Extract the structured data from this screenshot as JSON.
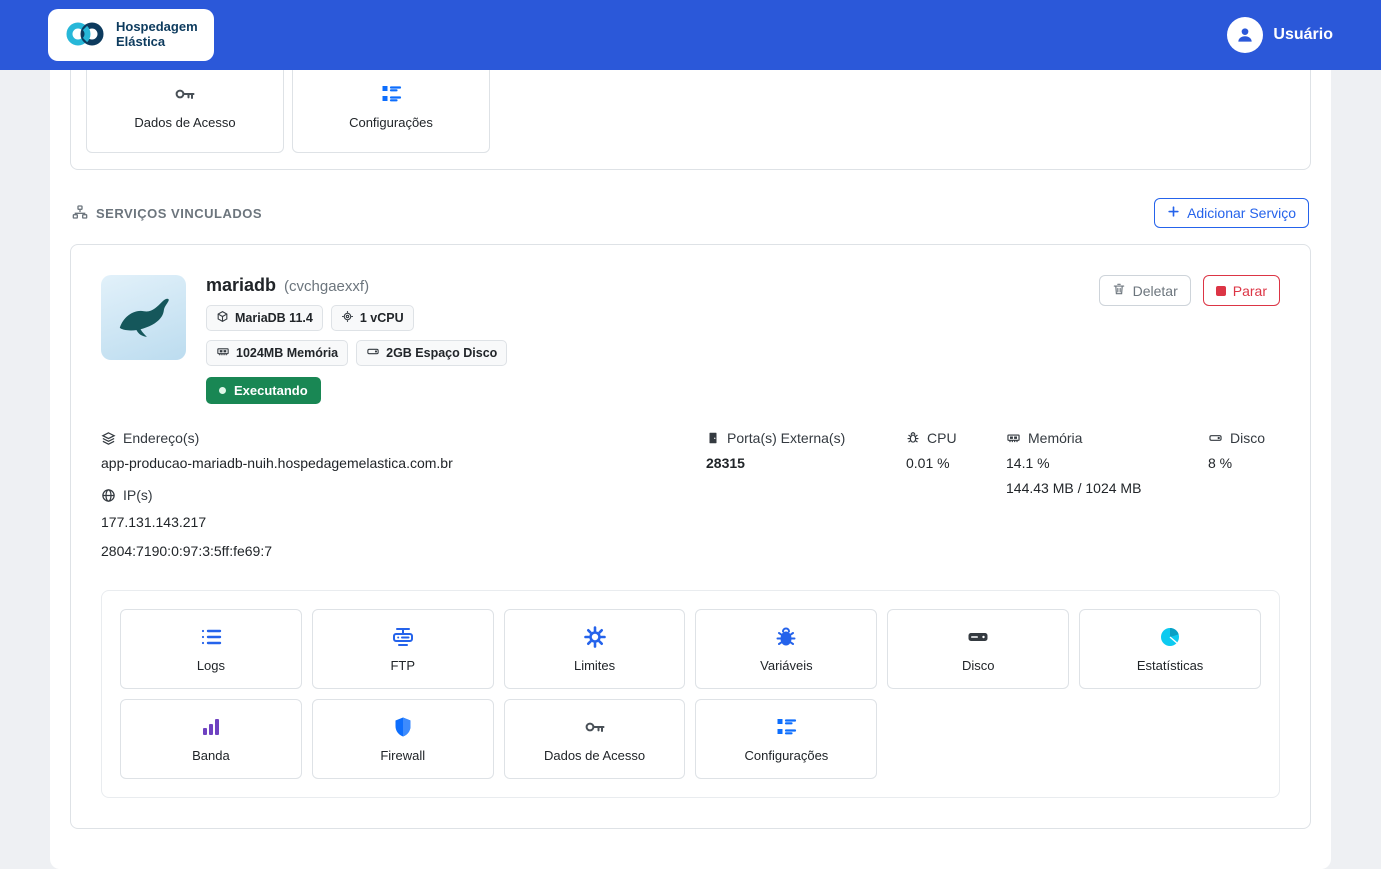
{
  "navbar": {
    "brand_line1": "Hospedagem",
    "brand_line2": "Elástica",
    "user_label": "Usuário"
  },
  "previous_card": {
    "tiles": [
      "Dados de Acesso",
      "Configurações"
    ]
  },
  "section": {
    "title": "SERVIÇOS VINCULADOS",
    "add_button": "Adicionar Serviço"
  },
  "service": {
    "name": "mariadb",
    "code": "(cvchgaexxf)",
    "badges": [
      "MariaDB 11.4",
      "1 vCPU",
      "1024MB Memória",
      "2GB Espaço Disco"
    ],
    "status": "Executando",
    "actions": {
      "delete": "Deletar",
      "stop": "Parar"
    },
    "info": {
      "address_label": "Endereço(s)",
      "address": "app-producao-mariadb-nuih.hospedagemelastica.com.br",
      "ip_label": "IP(s)",
      "ips": [
        "177.131.143.217",
        "2804:7190:0:97:3:5ff:fe69:7"
      ],
      "port_label": "Porta(s) Externa(s)",
      "port": "28315",
      "cpu_label": "CPU",
      "cpu_value": "0.01 %",
      "memory_label": "Memória",
      "memory_pct": "14.1 %",
      "memory_usage": "144.43 MB / 1024 MB",
      "disk_label": "Disco",
      "disk_value": "8 %"
    },
    "tiles": [
      "Logs",
      "FTP",
      "Limites",
      "Variáveis",
      "Disco",
      "Estatísticas",
      "Banda",
      "Firewall",
      "Dados de Acesso",
      "Configurações"
    ]
  },
  "colors": {
    "navbar_bg": "#2b58d9",
    "accent": "#2563eb",
    "success": "#198754",
    "danger": "#dc3545",
    "purple": "#6f42c1",
    "cyan": "#0dcaf0",
    "text_dark": "#212529",
    "text_gray": "#6c757d",
    "border": "#dee2e6",
    "page_bg": "#eef0f3"
  }
}
